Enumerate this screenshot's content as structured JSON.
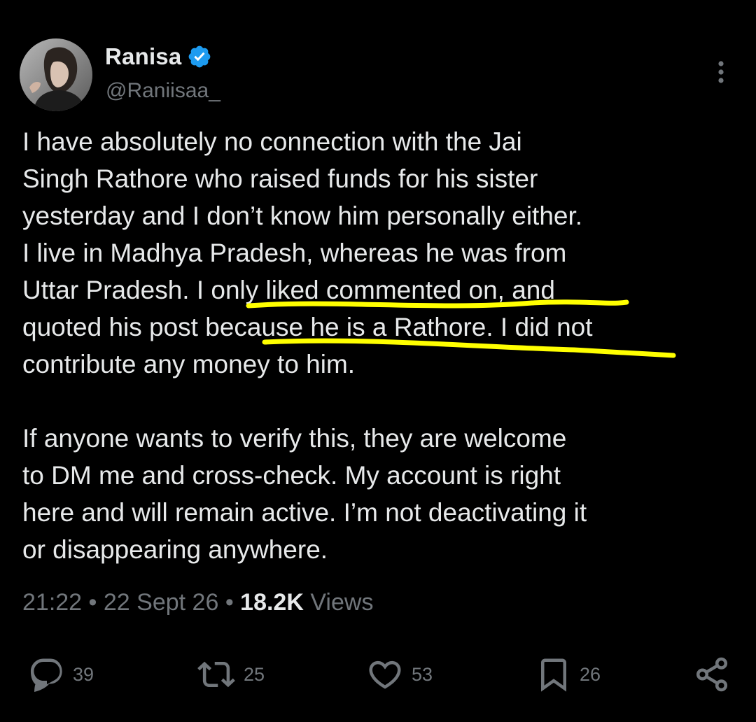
{
  "author": {
    "display_name": "Ranisa",
    "handle": "@Raniisaa_",
    "verified": true
  },
  "tweet": {
    "paragraphs": [
      "I have absolutely no connection with the Jai\nSingh Rathore who raised funds for his sister\nyesterday and I don’t know him personally either.\nI live in Madhya Pradesh, whereas he was from\nUttar Pradesh. I only liked commented on, and\nquoted his post because he is a Rathore. I did not\ncontribute any money to him.",
      "If anyone wants to verify this, they are welcome\nto DM me and cross-check. My account is right\nhere and will remain active. I’m not deactivating it\nor disappearing anywhere."
    ]
  },
  "meta": {
    "time": "21:22",
    "separator": " • ",
    "date": "22 Sept 26",
    "views_count": "18.2K",
    "views_label": "Views"
  },
  "actions": {
    "replies": "39",
    "reposts": "25",
    "likes": "53",
    "bookmarks": "26"
  },
  "icons": {
    "verified": "verified-badge-icon",
    "more": "more-vertical-icon",
    "reply": "reply-icon",
    "repost": "repost-icon",
    "like": "heart-icon",
    "bookmark": "bookmark-icon",
    "share": "share-icon"
  },
  "colors": {
    "background": "#000000",
    "text": "#e7e9ea",
    "secondary": "#71767b",
    "verified": "#1d9bf0",
    "highlight_marker": "#ffff00"
  }
}
